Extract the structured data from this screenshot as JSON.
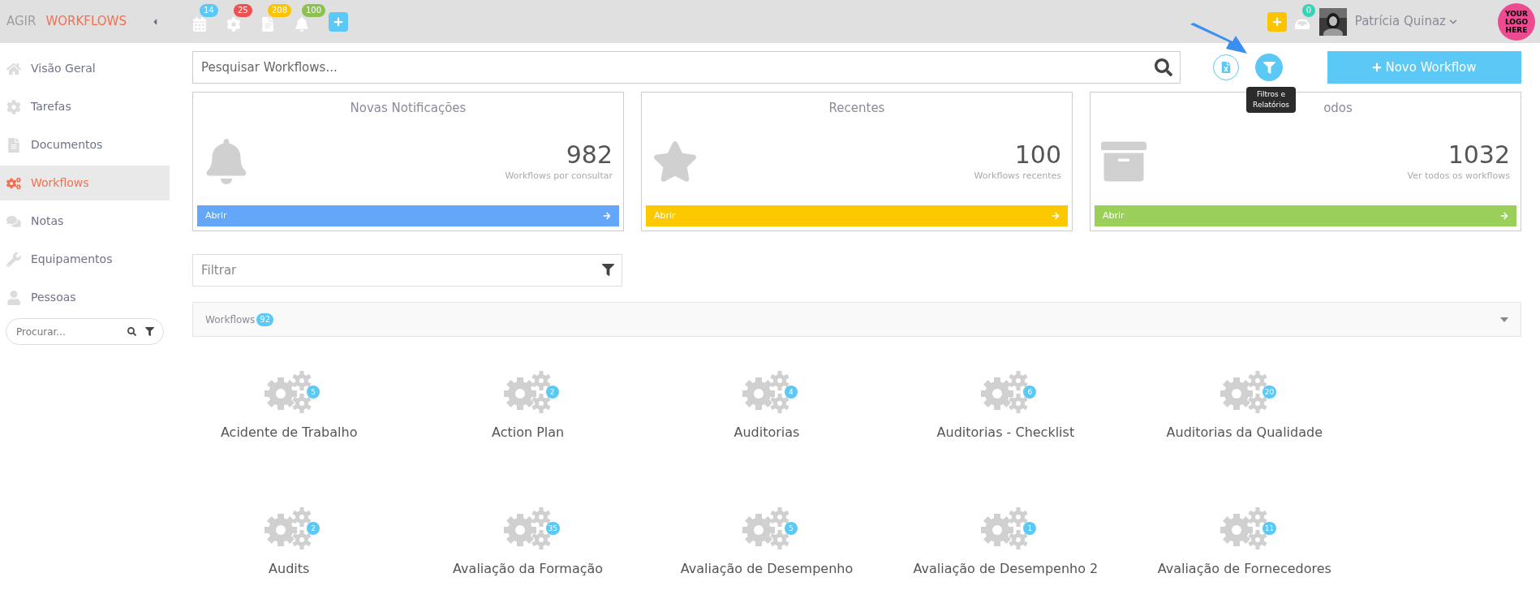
{
  "header": {
    "brand": "AGIR",
    "section": "WORKFLOWS",
    "counters": [
      {
        "kind": "calendar",
        "count": "14",
        "color": "#5bc8f5"
      },
      {
        "kind": "gear",
        "count": "25",
        "color": "#f05050"
      },
      {
        "kind": "document",
        "count": "208",
        "color": "#fcc400"
      },
      {
        "kind": "bell",
        "count": "100",
        "color": "#8cc152"
      }
    ],
    "inbox_count": "0",
    "user": "Patrícia Quinaz",
    "logo": "YOUR LOGO HERE"
  },
  "sidebar": {
    "items": [
      {
        "kind": "home",
        "label": "Visão Geral",
        "selected": false
      },
      {
        "kind": "gear",
        "label": "Tarefas",
        "selected": false
      },
      {
        "kind": "document",
        "label": "Documentos",
        "selected": false
      },
      {
        "kind": "gears",
        "label": "Workflows",
        "selected": true
      },
      {
        "kind": "chat",
        "label": "Notas",
        "selected": false
      },
      {
        "kind": "wrench",
        "label": "Equipamentos",
        "selected": false
      },
      {
        "kind": "person",
        "label": "Pessoas",
        "selected": false
      }
    ],
    "search": {
      "placeholder": "Procurar..."
    }
  },
  "search": {
    "placeholder": "Pesquisar Workflows..."
  },
  "tooltip": "Filtros e Relatórios",
  "new_button": "Novo Workflow",
  "cards": [
    {
      "kind": "bell",
      "title": "Novas Notificações",
      "value": "982",
      "caption": "Workflows por consultar",
      "action": "Abrir",
      "color": "#64a7f9"
    },
    {
      "kind": "star",
      "title": "Recentes",
      "value": "100",
      "caption": "Workflows recentes",
      "action": "Abrir",
      "color": "#fcc900"
    },
    {
      "kind": "archive",
      "title": "odos",
      "value": "1032",
      "caption": "Ver todos os workflows",
      "action": "Abrir",
      "color": "#9ad05a"
    }
  ],
  "filter": {
    "placeholder": "Filtrar"
  },
  "section": {
    "title": "Workflows",
    "count": "92"
  },
  "workflows": [
    {
      "name": "Acidente de Trabalho",
      "count": "5"
    },
    {
      "name": "Action Plan",
      "count": "2"
    },
    {
      "name": "Auditorias",
      "count": "4"
    },
    {
      "name": "Auditorias - Checklist",
      "count": "6"
    },
    {
      "name": "Auditorias da Qualidade",
      "count": "20"
    },
    {
      "name": "Audits",
      "count": "2"
    },
    {
      "name": "Avaliação da Formação",
      "count": "35"
    },
    {
      "name": "Avaliação de Desempenho",
      "count": "5"
    },
    {
      "name": "Avaliação de Desempenho 2",
      "count": "1"
    },
    {
      "name": "Avaliação de Fornecedores",
      "count": "11"
    }
  ]
}
